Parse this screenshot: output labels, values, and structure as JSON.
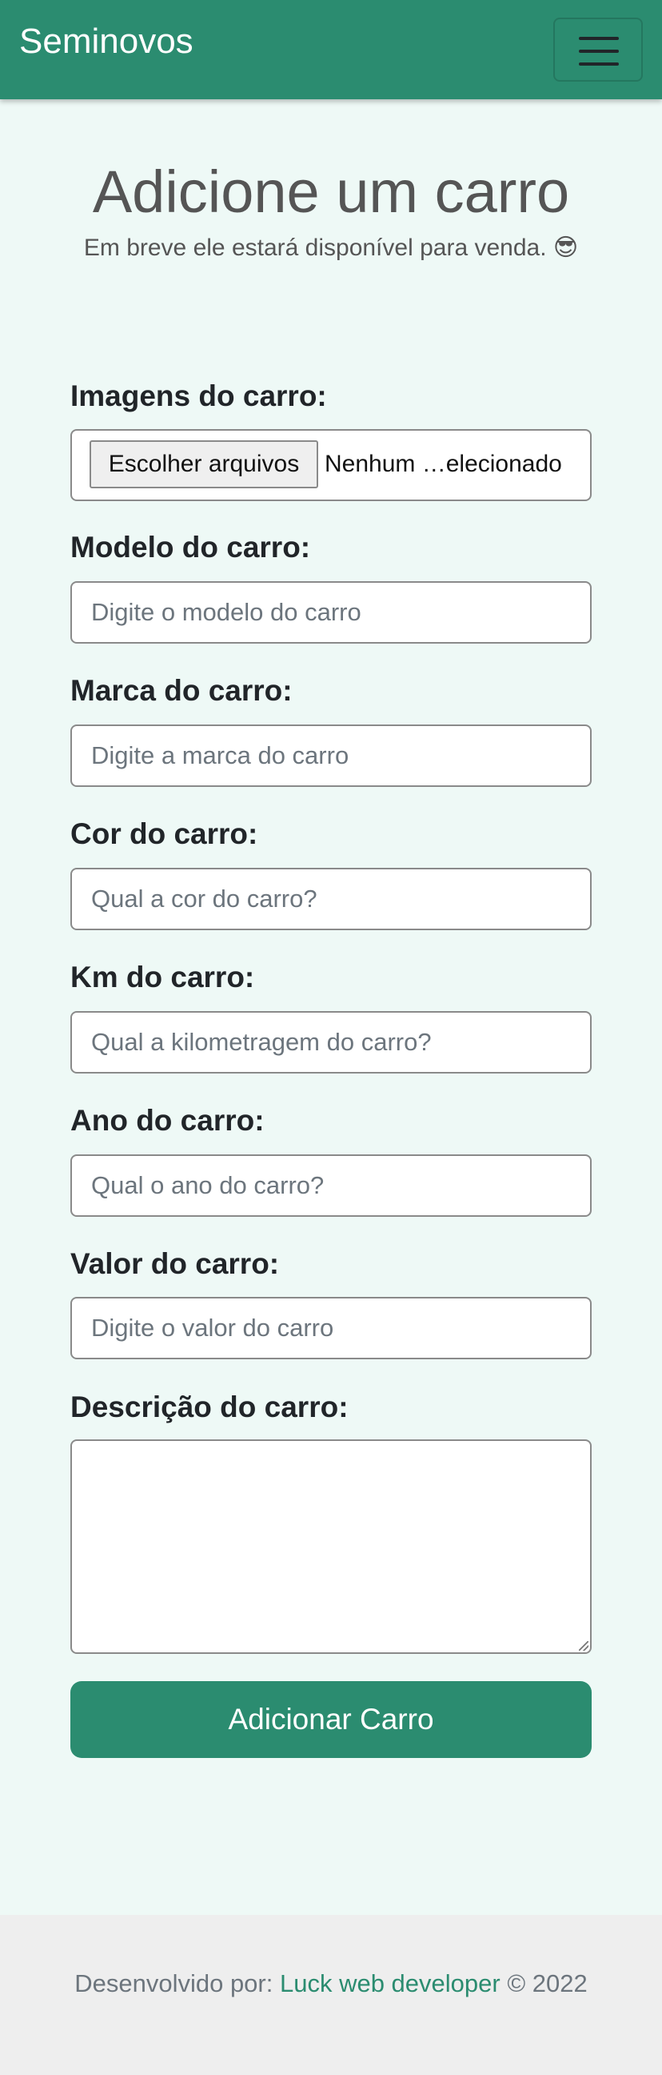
{
  "navbar": {
    "brand": "Seminovos",
    "menu_icon": "hamburger-menu-icon",
    "color": "#2b8c70"
  },
  "header": {
    "title": "Adicione um carro",
    "subtitle": "Em breve ele estará disponível para venda. 😎"
  },
  "form": {
    "images": {
      "label": "Imagens do carro:",
      "button_label": "Escolher arquivos",
      "status": "Nenhum …elecionado"
    },
    "model": {
      "label": "Modelo do carro:",
      "placeholder": "Digite o modelo do carro",
      "value": ""
    },
    "brand": {
      "label": "Marca do carro:",
      "placeholder": "Digite a marca do carro",
      "value": ""
    },
    "color": {
      "label": "Cor do carro:",
      "placeholder": "Qual a cor do carro?",
      "value": ""
    },
    "km": {
      "label": "Km do carro:",
      "placeholder": "Qual a kilometragem do carro?",
      "value": ""
    },
    "year": {
      "label": "Ano do carro:",
      "placeholder": "Qual o ano do carro?",
      "value": ""
    },
    "price": {
      "label": "Valor do carro:",
      "placeholder": "Digite o valor do carro",
      "value": ""
    },
    "description": {
      "label": "Descrição do carro:",
      "value": ""
    },
    "submit_label": "Adicionar Carro"
  },
  "footer": {
    "prefix": "Desenvolvido por:",
    "link_text": "Luck web developer",
    "suffix": "© 2022",
    "link_color": "#2b8c70"
  }
}
